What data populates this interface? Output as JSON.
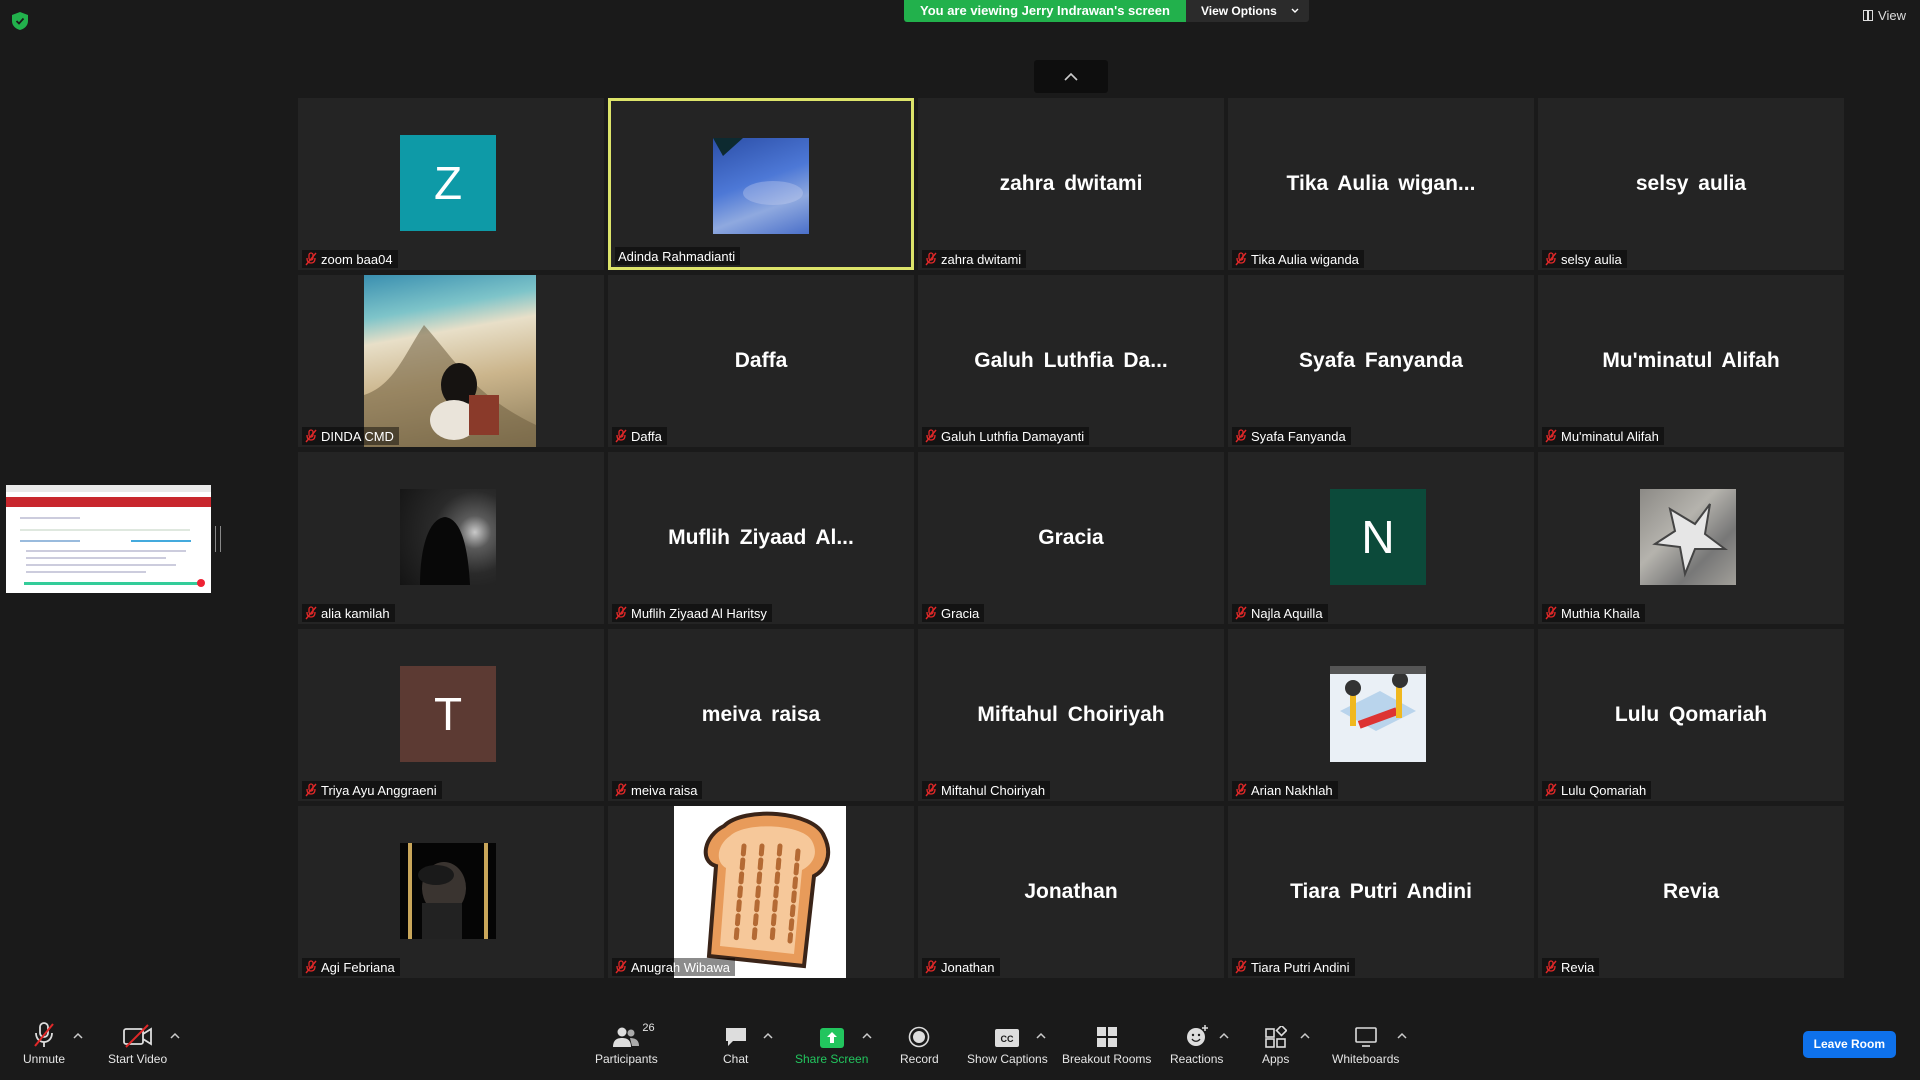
{
  "top": {
    "banner_text": "You are viewing Jerry Indrawan's screen",
    "view_options_label": "View Options",
    "view_label": "View"
  },
  "participants": [
    {
      "label": "zoom baa04",
      "big": "",
      "avatar": "Z",
      "avatar_color": "#0e9aa7",
      "kind": "avatar"
    },
    {
      "label": "Adinda Rahmadianti",
      "big": "",
      "kind": "sky",
      "active": true
    },
    {
      "label": "zahra dwitami",
      "big": "zahra dwitami",
      "kind": "text"
    },
    {
      "label": "Tika Aulia wiganda",
      "big": "Tika Aulia wigan...",
      "kind": "text"
    },
    {
      "label": "selsy aulia",
      "big": "selsy aulia",
      "kind": "text"
    },
    {
      "label": "DINDA CMD",
      "big": "",
      "kind": "beach"
    },
    {
      "label": "Daffa",
      "big": "Daffa",
      "kind": "text"
    },
    {
      "label": "Galuh Luthfia Damayanti",
      "big": "Galuh Luthfia Da...",
      "kind": "text"
    },
    {
      "label": "Syafa Fanyanda",
      "big": "Syafa Fanyanda",
      "kind": "text"
    },
    {
      "label": "Mu'minatul Alifah",
      "big": "Mu'minatul Alifah",
      "kind": "text"
    },
    {
      "label": "alia kamilah",
      "big": "",
      "kind": "dark"
    },
    {
      "label": "Muflih Ziyaad Al Haritsy",
      "big": "Muflih Ziyaad Al...",
      "kind": "text"
    },
    {
      "label": "Gracia",
      "big": "Gracia",
      "kind": "text"
    },
    {
      "label": "Najla Aquilla",
      "big": "",
      "avatar": "N",
      "avatar_color": "#0c4a3a",
      "kind": "avatar"
    },
    {
      "label": "Muthia Khaila",
      "big": "",
      "kind": "metal"
    },
    {
      "label": "Triya Ayu Anggraeni",
      "big": "",
      "avatar": "T",
      "avatar_color": "#5c3a33",
      "kind": "avatar"
    },
    {
      "label": "meiva raisa",
      "big": "meiva raisa",
      "kind": "text"
    },
    {
      "label": "Miftahul Choiriyah",
      "big": "Miftahul Choiriyah",
      "kind": "text"
    },
    {
      "label": "Arian Nakhlah",
      "big": "",
      "kind": "gym"
    },
    {
      "label": "Lulu Qomariah",
      "big": "Lulu Qomariah",
      "kind": "text"
    },
    {
      "label": "Agi Febriana",
      "big": "",
      "kind": "night"
    },
    {
      "label": "Anugrah Wibawa",
      "big": "",
      "kind": "toast"
    },
    {
      "label": "Jonathan",
      "big": "Jonathan",
      "kind": "text"
    },
    {
      "label": "Tiara Putri Andini",
      "big": "Tiara Putri Andini",
      "kind": "text"
    },
    {
      "label": "Revia",
      "big": "Revia",
      "kind": "text"
    }
  ],
  "toolbar": {
    "unmute": "Unmute",
    "start_video": "Start Video",
    "participants": "Participants",
    "participants_count": "26",
    "chat": "Chat",
    "share_screen": "Share Screen",
    "record": "Record",
    "show_captions": "Show Captions",
    "breakout_rooms": "Breakout Rooms",
    "reactions": "Reactions",
    "apps": "Apps",
    "whiteboards": "Whiteboards",
    "leave_room": "Leave Room"
  },
  "colors": {
    "accent_green": "#22b14c",
    "active_border": "#dde46a",
    "leave_blue": "#0e71eb",
    "muted_red": "#e02828"
  }
}
